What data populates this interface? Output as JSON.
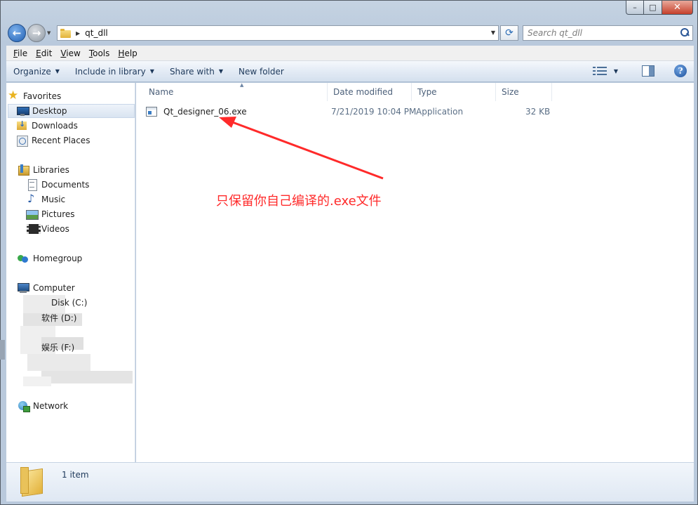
{
  "window": {
    "caption_buttons": {
      "minimize": "–",
      "maximize": "□",
      "close": "✕"
    }
  },
  "nav": {
    "back_icon": "back-arrow-icon",
    "forward_icon": "forward-arrow-icon",
    "address_path": "qt_dll",
    "search_placeholder": "Search qt_dll"
  },
  "menubar": {
    "items": [
      {
        "underline": "F",
        "rest": "ile"
      },
      {
        "underline": "E",
        "rest": "dit"
      },
      {
        "underline": "V",
        "rest": "iew"
      },
      {
        "underline": "T",
        "rest": "ools"
      },
      {
        "underline": "H",
        "rest": "elp"
      }
    ]
  },
  "toolbar": {
    "organize": "Organize",
    "include_in_library": "Include in library",
    "share_with": "Share with",
    "new_folder": "New folder",
    "help_glyph": "?"
  },
  "sidebar": {
    "favorites": "Favorites",
    "desktop": "Desktop",
    "downloads": "Downloads",
    "recent_places": "Recent Places",
    "libraries": "Libraries",
    "documents": "Documents",
    "music": "Music",
    "pictures": "Pictures",
    "videos": "Videos",
    "homegroup": "Homegroup",
    "computer": "Computer",
    "drive_c": "Disk (C:)",
    "drive_d": "软件 (D:)",
    "drive_f": "娱乐 (F:)",
    "network": "Network"
  },
  "columns": {
    "name": "Name",
    "date_modified": "Date modified",
    "type": "Type",
    "size": "Size"
  },
  "files": [
    {
      "name": "Qt_designer_06.exe",
      "date_modified": "7/21/2019 10:04 PM",
      "type": "Application",
      "size": "32 KB"
    }
  ],
  "annotation": {
    "text": "只保留你自己编译的.exe文件",
    "color": "#ff2a2a"
  },
  "status": {
    "item_count": "1 item"
  }
}
